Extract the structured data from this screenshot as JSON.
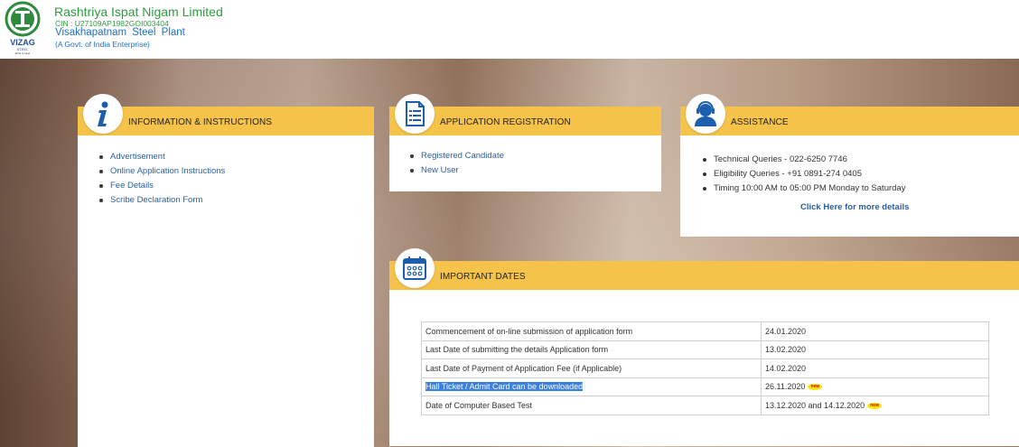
{
  "header": {
    "org_name": "Rashtriya Ispat Nigam Limited",
    "cin": "CIN : U27109AP1982GOI003404",
    "plant": "Visakhapatnam Steel Plant",
    "govt": "(A Govt. of India Enterprise)"
  },
  "info": {
    "title": "INFORMATION & INSTRUCTIONS",
    "items": [
      "Advertisement",
      "Online Application Instructions",
      "Fee Details",
      "Scribe Declaration Form"
    ]
  },
  "registration": {
    "title": "APPLICATION REGISTRATION",
    "items": [
      "Registered Candidate",
      "New User"
    ]
  },
  "assistance": {
    "title": "ASSISTANCE",
    "items": [
      "Technical Queries - 022-6250 7746",
      "Eligibility Queries - +91 0891-274 0405",
      "Timing 10:00 AM to 05:00 PM Monday to Saturday"
    ],
    "more_link": "Click Here for more details"
  },
  "dates": {
    "title": "IMPORTANT DATES",
    "rows": [
      {
        "event": "Commencement of on-line submission of application form",
        "date": "24.01.2020"
      },
      {
        "event": "Last Date of submitting the details Application form",
        "date": "13.02.2020"
      },
      {
        "event": "Last Date of Payment of Application Fee (if Applicable)",
        "date": "14.02.2020"
      },
      {
        "event": "Hall Ticket / Admit Card can be downloaded",
        "date": "26.11.2020"
      },
      {
        "event": "Date of Computer Based Test",
        "date": "13.12.2020 and 14.12.2020"
      }
    ],
    "new_badge": "new"
  },
  "colors": {
    "card_header": "#f5c24a",
    "link": "#2b5f9a",
    "brand_green": "#2e9b3e",
    "brand_blue": "#1d6fc6"
  }
}
